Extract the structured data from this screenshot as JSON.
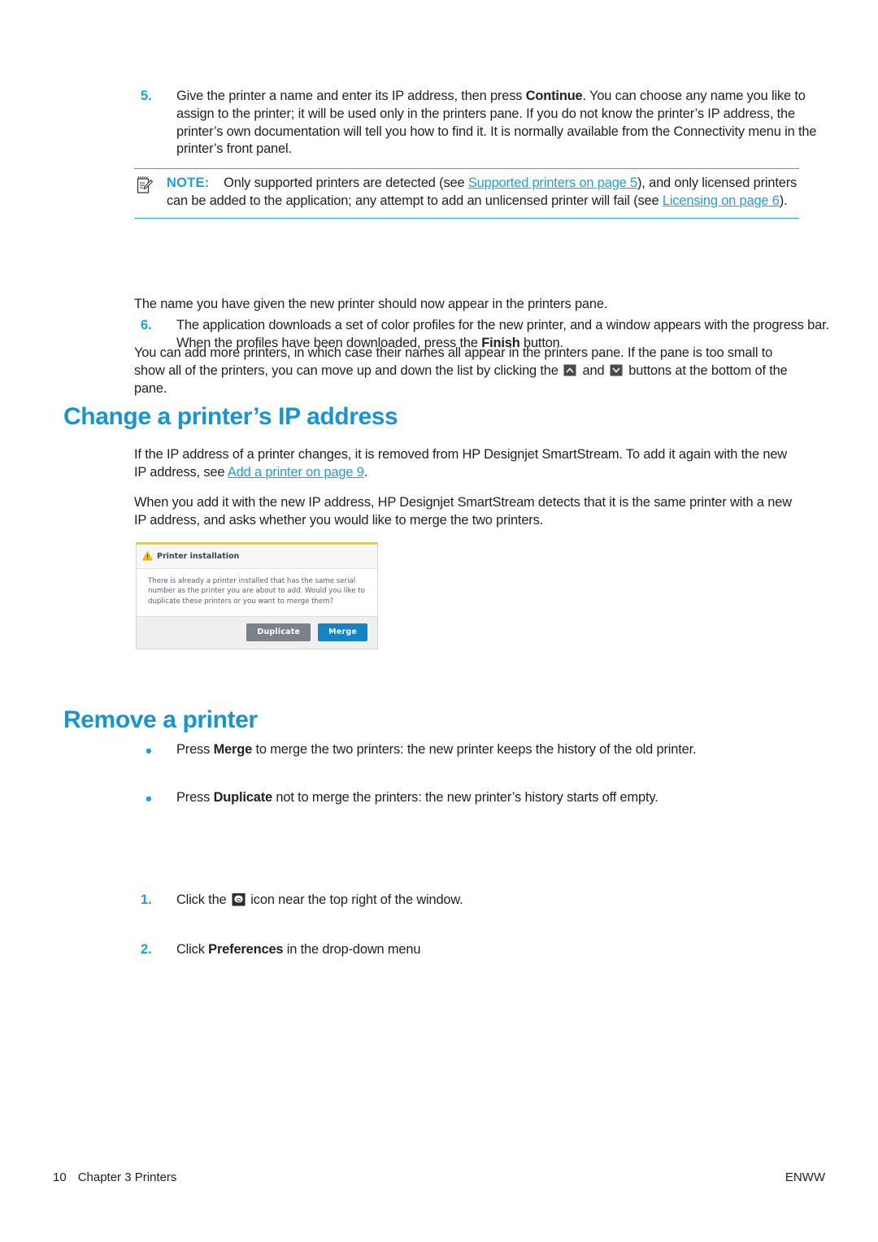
{
  "steps_continued": {
    "step5": {
      "marker": "5.",
      "text_a": "Give the printer a name and enter its IP address, then press ",
      "bold_a": "Continue",
      "text_b": ". You can choose any name you like to assign to the printer; it will be used only in the printers pane. If you do not know the printer’s IP address, the printer’s own documentation will tell you how to find it. It is normally available from the Connectivity menu in the printer’s front panel."
    },
    "note": {
      "icon": "note-pencil-icon",
      "label": "NOTE:",
      "text_a": "Only supported printers are detected (see ",
      "link_a": "Supported printers on page 5",
      "text_b": "), and only licensed printers can be added to the application; any attempt to add an unlicensed printer will fail (see ",
      "link_b": "Licensing on page 6",
      "text_c": ")."
    },
    "step6": {
      "marker": "6.",
      "text_a": "The application downloads a set of color profiles for the new printer, and a window appears with the progress bar. When the profiles have been downloaded, press the ",
      "bold_a": "Finish",
      "text_b": " button."
    },
    "para_name": "The name you have given the new printer should now appear in the printers pane.",
    "para_more": {
      "text_a": "You can add more printers, in which case their names all appear in the printers pane. If the pane is too small to show all of the printers, you can move up and down the list by clicking the ",
      "icon_up": "scroll-up-button-icon",
      "text_b": " and ",
      "icon_down": "scroll-down-button-icon",
      "text_c": " buttons at the bottom of the pane."
    }
  },
  "section_change_ip": {
    "heading": "Change a printer’s IP address",
    "para1": {
      "text_a": "If the IP address of a printer changes, it is removed from HP Designjet SmartStream. To add it again with the new IP address, see ",
      "link_a": "Add a printer on page 9",
      "text_b": "."
    },
    "para2": "When you add it with the new IP address, HP Designjet SmartStream detects that it is the same printer with a new IP address, and asks whether you would like to merge the two printers.",
    "dialog": {
      "warning_icon": "warning-triangle-icon",
      "title": "Printer installation",
      "body": "There is already a printer installed that has the same serial number as the printer you are about to add. Would you like to duplicate these printers or you want to merge them?",
      "button_secondary": "Duplicate",
      "button_primary": "Merge"
    },
    "bullets": [
      {
        "text_a": "Press ",
        "bold_a": "Merge",
        "text_b": " to merge the two printers: the new printer keeps the history of the old printer."
      },
      {
        "text_a": "Press ",
        "bold_a": "Duplicate",
        "text_b": " not to merge the printers: the new printer’s history starts off empty."
      }
    ]
  },
  "section_remove": {
    "heading": "Remove a printer",
    "step1": {
      "marker": "1.",
      "text_a": "Click the ",
      "icon": "gear-settings-icon",
      "text_b": " icon near the top right of the window."
    },
    "step2": {
      "marker": "2.",
      "text_a": "Click ",
      "bold_a": "Preferences",
      "text_b": " in the drop-down menu"
    }
  },
  "footer": {
    "page_number": "10",
    "chapter": "Chapter 3  Printers",
    "locale": "ENWW"
  },
  "colors": {
    "heading_blue": "#1695d4",
    "link_blue": "#1ba1db",
    "note_rule": "#2aa9e0",
    "dialog_primary": "#1484c8",
    "dialog_secondary": "#7c8189",
    "warning_yellow": "#f2d600"
  }
}
